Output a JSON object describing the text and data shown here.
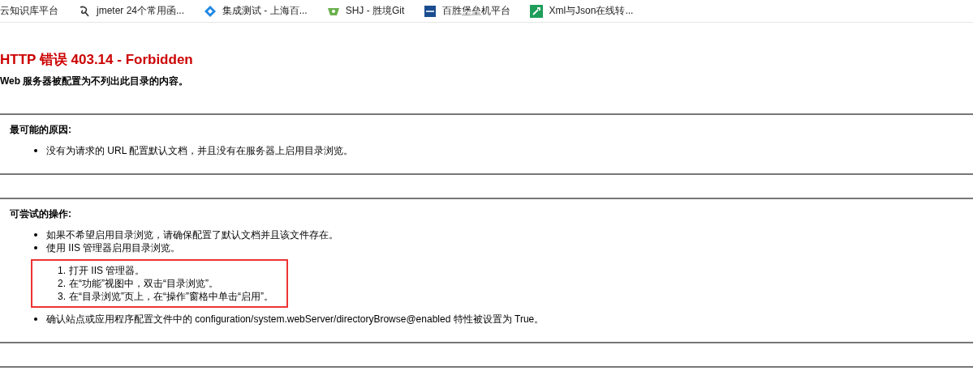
{
  "bookmarks": [
    {
      "label": "云知识库平台"
    },
    {
      "label": "jmeter 24个常用函..."
    },
    {
      "label": "集成测试 - 上海百..."
    },
    {
      "label": "SHJ - 胜境Git"
    },
    {
      "label": "百胜堡垒机平台"
    },
    {
      "label": "Xml与Json在线转..."
    }
  ],
  "error": {
    "title": "HTTP 错误 403.14 - Forbidden",
    "subtitle": "Web 服务器被配置为不列出此目录的内容。"
  },
  "sections": [
    {
      "heading": "最可能的原因:",
      "items": [
        {
          "text": "没有为请求的 URL 配置默认文档，并且没有在服务器上启用目录浏览。"
        }
      ]
    },
    {
      "heading": "可尝试的操作:",
      "items": [
        {
          "text": "如果不希望启用目录浏览，请确保配置了默认文档并且该文件存在。"
        },
        {
          "text": "使用 IIS 管理器启用目录浏览。",
          "steps": [
            {
              "number": "1.",
              "text": "打开 IIS 管理器。"
            },
            {
              "number": "2.",
              "text": "在“功能”视图中，双击“目录浏览”。"
            },
            {
              "number": "3.",
              "text": "在“目录浏览”页上，在“操作”窗格中单击“启用”。"
            }
          ],
          "highlighted": true
        },
        {
          "text": "确认站点或应用程序配置文件中的 configuration/system.webServer/directoryBrowse@enabled 特性被设置为 True。"
        }
      ]
    }
  ]
}
